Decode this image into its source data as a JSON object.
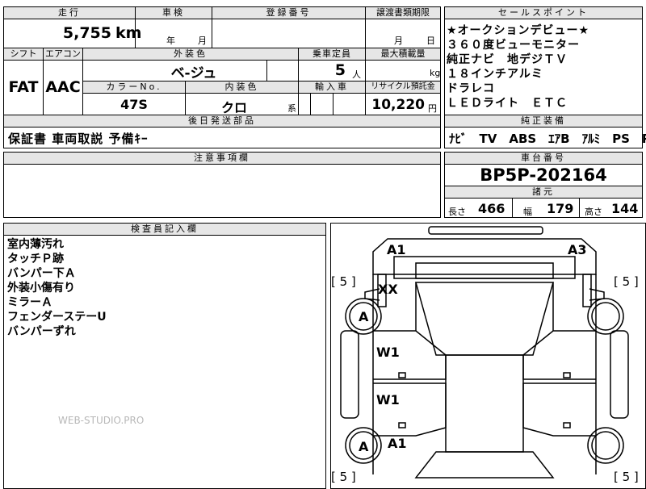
{
  "top_header": {
    "mileage_label": "走行",
    "shaken_label": "車検",
    "reg_label": "登録番号",
    "deadline_label": "譲渡書類期限",
    "sales_label": "セールスポイント"
  },
  "top_values": {
    "mileage": "5,755",
    "mileage_unit": "km",
    "shaken_year_unit": "年",
    "shaken_month_unit": "月",
    "deadline_month_unit": "月",
    "deadline_day_unit": "日"
  },
  "row2_header": {
    "shift_label": "シフト",
    "aircon_label": "エアコン",
    "exterior_color_label": "外装色",
    "capacity_label": "乗車定員",
    "max_load_label": "最大積載量"
  },
  "row2_values": {
    "shift": "FAT",
    "aircon": "AAC",
    "exterior_color": "ベ-ジュ",
    "capacity": "5",
    "capacity_unit": "人",
    "load_unit": "kg"
  },
  "row3_header": {
    "color_no_label": "カラーNo.",
    "interior_color_label": "内装色",
    "import_label": "輸入車",
    "recycle_label": "リサイクル預託金"
  },
  "row3_values": {
    "color_no": "47S",
    "interior_color": "クロ",
    "interior_suffix": "系",
    "recycle_fee": "10,220",
    "recycle_unit": "円"
  },
  "sales_points": [
    "★オークションデビュー★",
    "３６０度ビューモニター",
    "純正ナビ　地デジＴＶ",
    "１８インチアルミ",
    "ドラレコ",
    "ＬＥＤライト　ＥＴＣ"
  ],
  "later_parts": {
    "label": "後日発送部品",
    "value": "保証書 車両取説 予備ｷｰ"
  },
  "equipment": {
    "label": "純正装備",
    "value": "ﾅﾋﾞ　TV　ABS　ｴｱB　ｱﾙﾐ　PS　PW"
  },
  "notes": {
    "label": "注意事項欄"
  },
  "chassis": {
    "label": "車台番号",
    "value": "BP5P-202164"
  },
  "dimensions": {
    "label": "諸元",
    "length_label": "長さ",
    "length": "466",
    "width_label": "幅",
    "width": "179",
    "height_label": "高さ",
    "height": "144"
  },
  "inspector": {
    "label": "検査員記入欄",
    "lines": [
      "室内薄汚れ",
      "タッチＰ跡",
      "バンパー下Ａ",
      "外装小傷有り",
      "ミラーＡ",
      "フェンダーステーU",
      "バンパーずれ"
    ]
  },
  "watermark": "WEB-STUDIO.PRO",
  "diagram": {
    "a1_top": "A1",
    "a3_top": "A3",
    "xx": "XX",
    "a_front_left": "A",
    "w1_upper": "W1",
    "w1_lower": "W1",
    "a_rear_left": "A",
    "a1_rear": "A1",
    "tread_fl": "[ 5 ]",
    "tread_fr": "[ 5 ]",
    "tread_rl": "[ 5 ]",
    "tread_rr": "[ 5 ]"
  }
}
